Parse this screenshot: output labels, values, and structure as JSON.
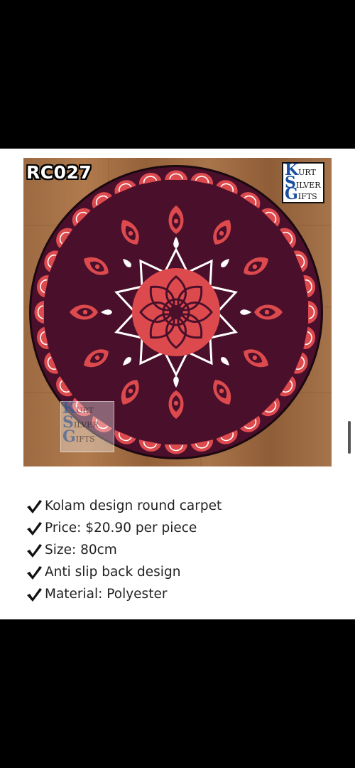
{
  "product": {
    "code": "RC027",
    "brand_logo_text": [
      "URT",
      "ILVER",
      "IFTS"
    ],
    "watermark_text": [
      "URT",
      "ILVER",
      "IFTS"
    ]
  },
  "features": [
    {
      "icon": "checkmark-icon",
      "text": "Kolam design round carpet"
    },
    {
      "icon": "checkmark-icon",
      "text": "Price: $20.90 per piece"
    },
    {
      "icon": "checkmark-icon",
      "text": "Size: 80cm"
    },
    {
      "icon": "checkmark-icon",
      "text": "Anti slip back design"
    },
    {
      "icon": "checkmark-icon",
      "text": "Material: Polyester"
    }
  ],
  "colors": {
    "carpet_dark": "#4a0f2a",
    "carpet_red": "#dc4a4e",
    "floor_wood": "#a06e45",
    "text": "#222222"
  }
}
